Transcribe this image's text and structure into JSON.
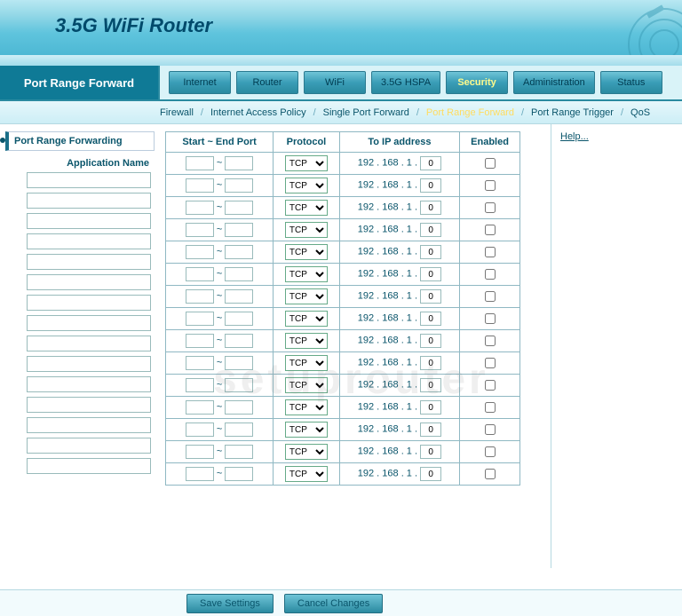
{
  "banner": {
    "title": "3.5G WiFi Router"
  },
  "page_title": "Port Range Forward",
  "tabs": [
    {
      "label": "Internet",
      "active": false
    },
    {
      "label": "Router",
      "active": false
    },
    {
      "label": "WiFi",
      "active": false
    },
    {
      "label": "3.5G HSPA",
      "active": false
    },
    {
      "label": "Security",
      "active": true
    },
    {
      "label": "Administration",
      "active": false
    },
    {
      "label": "Status",
      "active": false
    }
  ],
  "subnav": [
    {
      "label": "Firewall",
      "current": false
    },
    {
      "label": "Internet Access Policy",
      "current": false
    },
    {
      "label": "Single Port Forward",
      "current": false
    },
    {
      "label": "Port Range Forward",
      "current": true
    },
    {
      "label": "Port Range Trigger",
      "current": false
    },
    {
      "label": "QoS",
      "current": false
    }
  ],
  "section_label": "Port Range Forwarding",
  "left_header": "Application Name",
  "table_headers": {
    "port": "Start ~ End Port",
    "protocol": "Protocol",
    "ip": "To IP address",
    "enabled": "Enabled"
  },
  "ip_prefix": "192 . 168 . 1 .",
  "port_sep": "~",
  "protocol_default": "TCP",
  "rows": [
    {
      "app": "",
      "start": "",
      "end": "",
      "protocol": "TCP",
      "ip_last": "0",
      "enabled": false
    },
    {
      "app": "",
      "start": "",
      "end": "",
      "protocol": "TCP",
      "ip_last": "0",
      "enabled": false
    },
    {
      "app": "",
      "start": "",
      "end": "",
      "protocol": "TCP",
      "ip_last": "0",
      "enabled": false
    },
    {
      "app": "",
      "start": "",
      "end": "",
      "protocol": "TCP",
      "ip_last": "0",
      "enabled": false
    },
    {
      "app": "",
      "start": "",
      "end": "",
      "protocol": "TCP",
      "ip_last": "0",
      "enabled": false
    },
    {
      "app": "",
      "start": "",
      "end": "",
      "protocol": "TCP",
      "ip_last": "0",
      "enabled": false
    },
    {
      "app": "",
      "start": "",
      "end": "",
      "protocol": "TCP",
      "ip_last": "0",
      "enabled": false
    },
    {
      "app": "",
      "start": "",
      "end": "",
      "protocol": "TCP",
      "ip_last": "0",
      "enabled": false
    },
    {
      "app": "",
      "start": "",
      "end": "",
      "protocol": "TCP",
      "ip_last": "0",
      "enabled": false
    },
    {
      "app": "",
      "start": "",
      "end": "",
      "protocol": "TCP",
      "ip_last": "0",
      "enabled": false
    },
    {
      "app": "",
      "start": "",
      "end": "",
      "protocol": "TCP",
      "ip_last": "0",
      "enabled": false
    },
    {
      "app": "",
      "start": "",
      "end": "",
      "protocol": "TCP",
      "ip_last": "0",
      "enabled": false
    },
    {
      "app": "",
      "start": "",
      "end": "",
      "protocol": "TCP",
      "ip_last": "0",
      "enabled": false
    },
    {
      "app": "",
      "start": "",
      "end": "",
      "protocol": "TCP",
      "ip_last": "0",
      "enabled": false
    },
    {
      "app": "",
      "start": "",
      "end": "",
      "protocol": "TCP",
      "ip_last": "0",
      "enabled": false
    }
  ],
  "help_link": "Help...",
  "buttons": {
    "save": "Save Settings",
    "cancel": "Cancel Changes"
  },
  "watermark": "setuprouter"
}
